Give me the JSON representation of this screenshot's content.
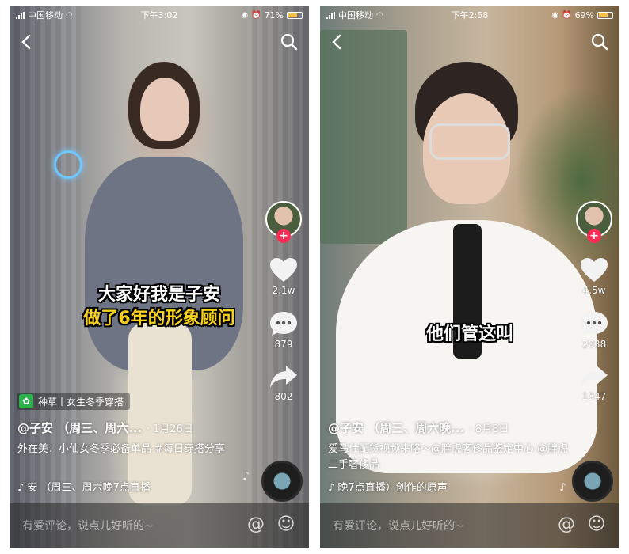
{
  "screens": [
    {
      "status": {
        "carrier": "中国移动",
        "time": "下午3:02",
        "battery": "71%",
        "battery_level": 0.71
      },
      "caption_line1": "大家好我是子安",
      "caption_line2": "做了6年的形象顾问",
      "tag_label": "种草丨女生冬季穿搭",
      "author": "@子安 （周三、周六...",
      "date": "· 1月26日",
      "desc": "外在美：小仙女冬季必备单品 #每日穿搭分享",
      "music": "♪ 安 （周三、周六晚7点直播",
      "likes": "2.1w",
      "comments": "879",
      "shares": "802",
      "comment_placeholder": "有爱评论，说点儿好听的~"
    },
    {
      "status": {
        "carrier": "中国移动",
        "time": "下午2:58",
        "battery": "69%",
        "battery_level": 0.69
      },
      "caption_line1": "他们管这叫",
      "author": "@子安 （周三、周六晚...",
      "date": "· 8月8日",
      "desc": "爱马仕配货视频来咯～@胖虎奢侈品鉴定中心 @胖虎二手奢侈品",
      "music": "♪ 晚7点直播）创作的原声",
      "likes": "4.5w",
      "comments": "2038",
      "shares": "1347",
      "comment_placeholder": "有爱评论，说点儿好听的~"
    }
  ],
  "icons": {
    "back": "chevron-left-icon",
    "search": "search-icon",
    "like": "heart-icon",
    "comment": "comment-icon",
    "share": "share-icon",
    "mention": "at-icon",
    "emoji": "emoji-icon",
    "tag": "sprout-icon"
  },
  "colors": {
    "follow": "#fe2c55",
    "caption_yellow": "#f7d21c",
    "tag_green": "#2bb34a"
  }
}
